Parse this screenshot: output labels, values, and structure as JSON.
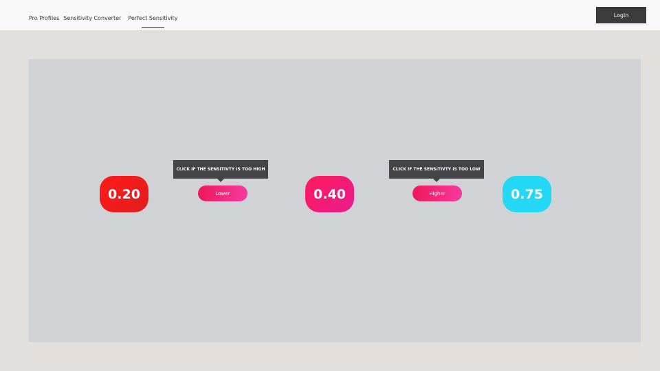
{
  "nav": {
    "items": [
      {
        "label": "Pro Profiles"
      },
      {
        "label": "Sensitivity Converter"
      },
      {
        "label": "Perfect Sensitivity",
        "active": true
      }
    ]
  },
  "header": {
    "login_label": "Login"
  },
  "main": {
    "values": {
      "low": "0.20",
      "current": "0.40",
      "high": "0.75"
    },
    "lower": {
      "tooltip": "CLICK IF THE SENSITIVTY IS TOO HIGH",
      "button_label": "Lower"
    },
    "higher": {
      "tooltip": "CLICK IF THE SENSITIVTY IS TOO LOW",
      "button_label": "Higher"
    }
  },
  "colors": {
    "low_pill": "#ff1a1a",
    "mid_pill": "#f01c70",
    "high_pill": "#22d8f5",
    "button": "#f0185c",
    "tooltip_bg": "#444446",
    "login_bg": "#3b3b3b"
  }
}
